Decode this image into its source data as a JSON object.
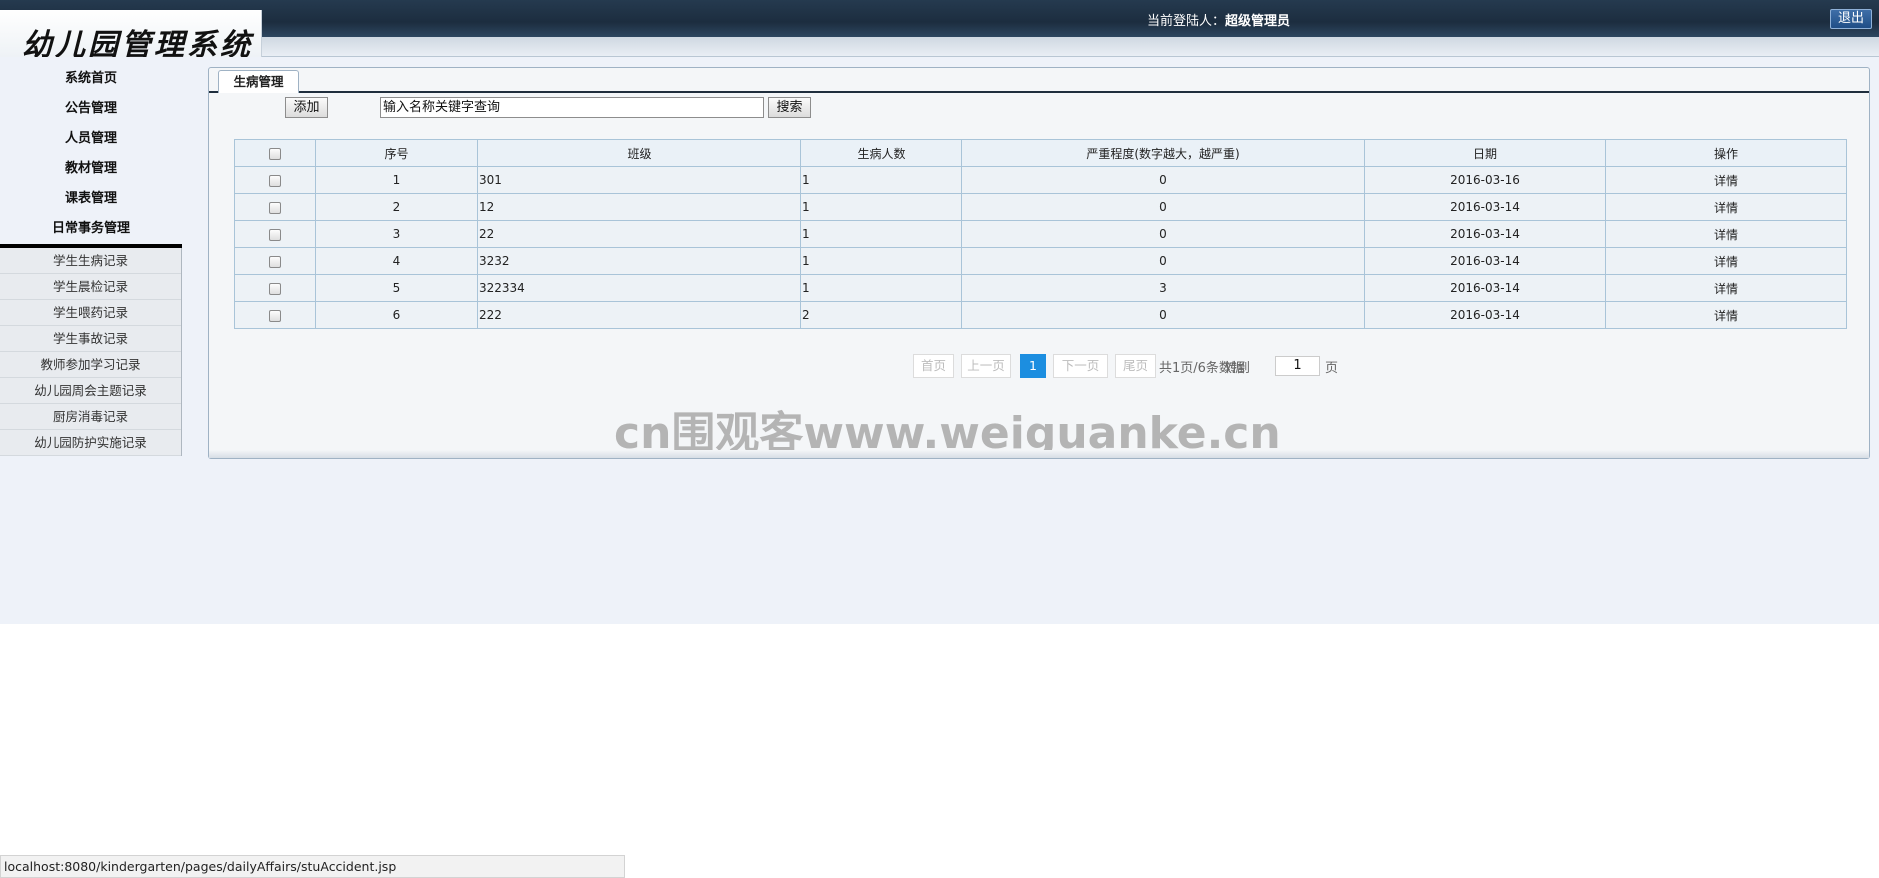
{
  "header": {
    "app_title": "幼儿园管理系统",
    "login_label": "当前登陆人：",
    "login_user": "超级管理员",
    "logout_label": "退出"
  },
  "sidebar": {
    "items": [
      {
        "label": "系统首页"
      },
      {
        "label": "公告管理"
      },
      {
        "label": "人员管理"
      },
      {
        "label": "教材管理"
      },
      {
        "label": "课表管理"
      },
      {
        "label": "日常事务管理"
      }
    ],
    "sub_items": [
      {
        "label": "学生生病记录"
      },
      {
        "label": "学生晨检记录"
      },
      {
        "label": "学生喂药记录"
      },
      {
        "label": "学生事故记录"
      },
      {
        "label": "教师参加学习记录"
      },
      {
        "label": "幼儿园周会主题记录"
      },
      {
        "label": "厨房消毒记录"
      },
      {
        "label": "幼儿园防护实施记录"
      }
    ]
  },
  "main": {
    "tab_label": "生病管理",
    "add_label": "添加",
    "search_value": "输入名称关键字查询",
    "search_label": "搜索",
    "table": {
      "headers": [
        "序号",
        "班级",
        "生病人数",
        "严重程度(数字越大，越严重)",
        "日期",
        "操作"
      ],
      "rows": [
        {
          "seq": "1",
          "class": "301",
          "count": "1",
          "severity": "0",
          "date": "2016-03-16",
          "action": "详情"
        },
        {
          "seq": "2",
          "class": "12",
          "count": "1",
          "severity": "0",
          "date": "2016-03-14",
          "action": "详情"
        },
        {
          "seq": "3",
          "class": "22",
          "count": "1",
          "severity": "0",
          "date": "2016-03-14",
          "action": "详情"
        },
        {
          "seq": "4",
          "class": "3232",
          "count": "1",
          "severity": "0",
          "date": "2016-03-14",
          "action": "详情"
        },
        {
          "seq": "5",
          "class": "322334",
          "count": "1",
          "severity": "3",
          "date": "2016-03-14",
          "action": "详情"
        },
        {
          "seq": "6",
          "class": "222",
          "count": "2",
          "severity": "0",
          "date": "2016-03-14",
          "action": "详情"
        }
      ]
    },
    "pager": {
      "first": "首页",
      "prev": "上一页",
      "current": "1",
      "next": "下一页",
      "last": "尾页",
      "info": "共1页/6条数据",
      "goto_label": "转到",
      "goto_value": "1",
      "page_unit": "页"
    },
    "watermark": "cn围观客www.weiguanke.cn"
  },
  "statusbar": {
    "url": "localhost:8080/kindergarten/pages/dailyAffairs/stuAccident.jsp"
  }
}
